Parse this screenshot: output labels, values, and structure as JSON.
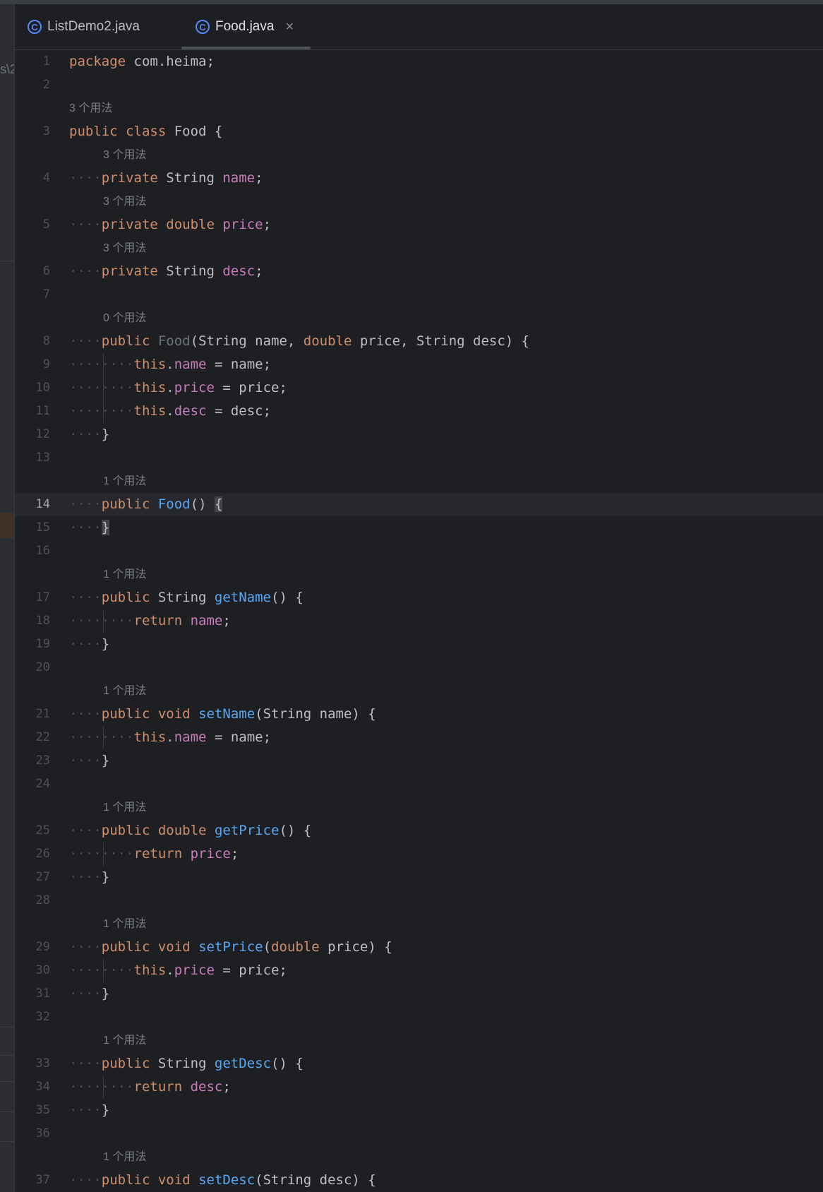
{
  "tabs": [
    {
      "name": "ListDemo2.java",
      "icon": "class-c-icon",
      "active": false
    },
    {
      "name": "Food.java",
      "icon": "class-c-icon",
      "active": true,
      "close": "×"
    }
  ],
  "left_panel_text": "s\\2",
  "colors": {
    "background": "#1e1f22",
    "keyword": "#cf8e6d",
    "field": "#c77dbb",
    "method": "#56a8f5",
    "text": "#bcbec4",
    "hint": "#7a7e85",
    "line_number": "#4e5157"
  },
  "editor": {
    "caret_line": "14",
    "rows": [
      {
        "type": "code",
        "ln": "1",
        "indent": 0,
        "tokens": [
          {
            "t": "package",
            "c": "kw"
          },
          {
            "t": " com.heima;"
          }
        ]
      },
      {
        "type": "code",
        "ln": "2",
        "indent": 0,
        "tokens": []
      },
      {
        "type": "hint",
        "indent": 0,
        "text": "3 个用法"
      },
      {
        "type": "code",
        "ln": "3",
        "indent": 0,
        "tokens": [
          {
            "t": "public",
            "c": "kw"
          },
          {
            "t": " "
          },
          {
            "t": "class",
            "c": "kw"
          },
          {
            "t": " Food {"
          }
        ]
      },
      {
        "type": "hint",
        "indent": 1,
        "text": "3 个用法"
      },
      {
        "type": "code",
        "ln": "4",
        "indent": 1,
        "tokens": [
          {
            "t": "private",
            "c": "kw"
          },
          {
            "t": " String "
          },
          {
            "t": "name",
            "c": "fld"
          },
          {
            "t": ";"
          }
        ]
      },
      {
        "type": "hint",
        "indent": 1,
        "text": "3 个用法"
      },
      {
        "type": "code",
        "ln": "5",
        "indent": 1,
        "tokens": [
          {
            "t": "private",
            "c": "kw"
          },
          {
            "t": " "
          },
          {
            "t": "double",
            "c": "kw"
          },
          {
            "t": " "
          },
          {
            "t": "price",
            "c": "fld"
          },
          {
            "t": ";"
          }
        ]
      },
      {
        "type": "hint",
        "indent": 1,
        "text": "3 个用法"
      },
      {
        "type": "code",
        "ln": "6",
        "indent": 1,
        "tokens": [
          {
            "t": "private",
            "c": "kw"
          },
          {
            "t": " String "
          },
          {
            "t": "desc",
            "c": "fld"
          },
          {
            "t": ";"
          }
        ]
      },
      {
        "type": "code",
        "ln": "7",
        "indent": 0,
        "tokens": []
      },
      {
        "type": "hint",
        "indent": 1,
        "text": "0 个用法"
      },
      {
        "type": "code",
        "ln": "8",
        "indent": 1,
        "tokens": [
          {
            "t": "public",
            "c": "kw"
          },
          {
            "t": " "
          },
          {
            "t": "Food",
            "c": "unused"
          },
          {
            "t": "(String name, "
          },
          {
            "t": "double",
            "c": "kw"
          },
          {
            "t": " price, String desc) {"
          }
        ]
      },
      {
        "type": "code",
        "ln": "9",
        "indent": 2,
        "tokens": [
          {
            "t": "this",
            "c": "kw"
          },
          {
            "t": "."
          },
          {
            "t": "name",
            "c": "fld"
          },
          {
            "t": " = name;"
          }
        ]
      },
      {
        "type": "code",
        "ln": "10",
        "indent": 2,
        "tokens": [
          {
            "t": "this",
            "c": "kw"
          },
          {
            "t": "."
          },
          {
            "t": "price",
            "c": "fld"
          },
          {
            "t": " = price;"
          }
        ]
      },
      {
        "type": "code",
        "ln": "11",
        "indent": 2,
        "tokens": [
          {
            "t": "this",
            "c": "kw"
          },
          {
            "t": "."
          },
          {
            "t": "desc",
            "c": "fld"
          },
          {
            "t": " = desc;"
          }
        ]
      },
      {
        "type": "code",
        "ln": "12",
        "indent": 1,
        "tokens": [
          {
            "t": "}"
          }
        ]
      },
      {
        "type": "code",
        "ln": "13",
        "indent": 0,
        "tokens": []
      },
      {
        "type": "hint",
        "indent": 1,
        "text": "1 个用法"
      },
      {
        "type": "code",
        "ln": "14",
        "indent": 1,
        "tokens": [
          {
            "t": "public",
            "c": "kw"
          },
          {
            "t": " "
          },
          {
            "t": "Food",
            "c": "ctor"
          },
          {
            "t": "() "
          },
          {
            "t": "{",
            "c": "brace-hl"
          }
        ]
      },
      {
        "type": "code",
        "ln": "15",
        "indent": 1,
        "tokens": [
          {
            "t": "}",
            "c": "brace-hl"
          }
        ]
      },
      {
        "type": "code",
        "ln": "16",
        "indent": 0,
        "tokens": []
      },
      {
        "type": "hint",
        "indent": 1,
        "text": "1 个用法"
      },
      {
        "type": "code",
        "ln": "17",
        "indent": 1,
        "tokens": [
          {
            "t": "public",
            "c": "kw"
          },
          {
            "t": " String "
          },
          {
            "t": "getName",
            "c": "fn"
          },
          {
            "t": "() {"
          }
        ]
      },
      {
        "type": "code",
        "ln": "18",
        "indent": 2,
        "tokens": [
          {
            "t": "return",
            "c": "kw"
          },
          {
            "t": " "
          },
          {
            "t": "name",
            "c": "fld"
          },
          {
            "t": ";"
          }
        ]
      },
      {
        "type": "code",
        "ln": "19",
        "indent": 1,
        "tokens": [
          {
            "t": "}"
          }
        ]
      },
      {
        "type": "code",
        "ln": "20",
        "indent": 0,
        "tokens": []
      },
      {
        "type": "hint",
        "indent": 1,
        "text": "1 个用法"
      },
      {
        "type": "code",
        "ln": "21",
        "indent": 1,
        "tokens": [
          {
            "t": "public",
            "c": "kw"
          },
          {
            "t": " "
          },
          {
            "t": "void",
            "c": "kw"
          },
          {
            "t": " "
          },
          {
            "t": "setName",
            "c": "fn"
          },
          {
            "t": "(String name) {"
          }
        ]
      },
      {
        "type": "code",
        "ln": "22",
        "indent": 2,
        "tokens": [
          {
            "t": "this",
            "c": "kw"
          },
          {
            "t": "."
          },
          {
            "t": "name",
            "c": "fld"
          },
          {
            "t": " = name;"
          }
        ]
      },
      {
        "type": "code",
        "ln": "23",
        "indent": 1,
        "tokens": [
          {
            "t": "}"
          }
        ]
      },
      {
        "type": "code",
        "ln": "24",
        "indent": 0,
        "tokens": []
      },
      {
        "type": "hint",
        "indent": 1,
        "text": "1 个用法"
      },
      {
        "type": "code",
        "ln": "25",
        "indent": 1,
        "tokens": [
          {
            "t": "public",
            "c": "kw"
          },
          {
            "t": " "
          },
          {
            "t": "double",
            "c": "kw"
          },
          {
            "t": " "
          },
          {
            "t": "getPrice",
            "c": "fn"
          },
          {
            "t": "() {"
          }
        ]
      },
      {
        "type": "code",
        "ln": "26",
        "indent": 2,
        "tokens": [
          {
            "t": "return",
            "c": "kw"
          },
          {
            "t": " "
          },
          {
            "t": "price",
            "c": "fld"
          },
          {
            "t": ";"
          }
        ]
      },
      {
        "type": "code",
        "ln": "27",
        "indent": 1,
        "tokens": [
          {
            "t": "}"
          }
        ]
      },
      {
        "type": "code",
        "ln": "28",
        "indent": 0,
        "tokens": []
      },
      {
        "type": "hint",
        "indent": 1,
        "text": "1 个用法"
      },
      {
        "type": "code",
        "ln": "29",
        "indent": 1,
        "tokens": [
          {
            "t": "public",
            "c": "kw"
          },
          {
            "t": " "
          },
          {
            "t": "void",
            "c": "kw"
          },
          {
            "t": " "
          },
          {
            "t": "setPrice",
            "c": "fn"
          },
          {
            "t": "("
          },
          {
            "t": "double",
            "c": "kw"
          },
          {
            "t": " price) {"
          }
        ]
      },
      {
        "type": "code",
        "ln": "30",
        "indent": 2,
        "tokens": [
          {
            "t": "this",
            "c": "kw"
          },
          {
            "t": "."
          },
          {
            "t": "price",
            "c": "fld"
          },
          {
            "t": " = price;"
          }
        ]
      },
      {
        "type": "code",
        "ln": "31",
        "indent": 1,
        "tokens": [
          {
            "t": "}"
          }
        ]
      },
      {
        "type": "code",
        "ln": "32",
        "indent": 0,
        "tokens": []
      },
      {
        "type": "hint",
        "indent": 1,
        "text": "1 个用法"
      },
      {
        "type": "code",
        "ln": "33",
        "indent": 1,
        "tokens": [
          {
            "t": "public",
            "c": "kw"
          },
          {
            "t": " String "
          },
          {
            "t": "getDesc",
            "c": "fn"
          },
          {
            "t": "() {"
          }
        ]
      },
      {
        "type": "code",
        "ln": "34",
        "indent": 2,
        "tokens": [
          {
            "t": "return",
            "c": "kw"
          },
          {
            "t": " "
          },
          {
            "t": "desc",
            "c": "fld"
          },
          {
            "t": ";"
          }
        ]
      },
      {
        "type": "code",
        "ln": "35",
        "indent": 1,
        "tokens": [
          {
            "t": "}"
          }
        ]
      },
      {
        "type": "code",
        "ln": "36",
        "indent": 0,
        "tokens": []
      },
      {
        "type": "hint",
        "indent": 1,
        "text": "1 个用法"
      },
      {
        "type": "code",
        "ln": "37",
        "indent": 1,
        "tokens": [
          {
            "t": "public",
            "c": "kw"
          },
          {
            "t": " "
          },
          {
            "t": "void",
            "c": "kw"
          },
          {
            "t": " "
          },
          {
            "t": "setDesc",
            "c": "fn"
          },
          {
            "t": "(String desc) {"
          }
        ]
      }
    ]
  }
}
